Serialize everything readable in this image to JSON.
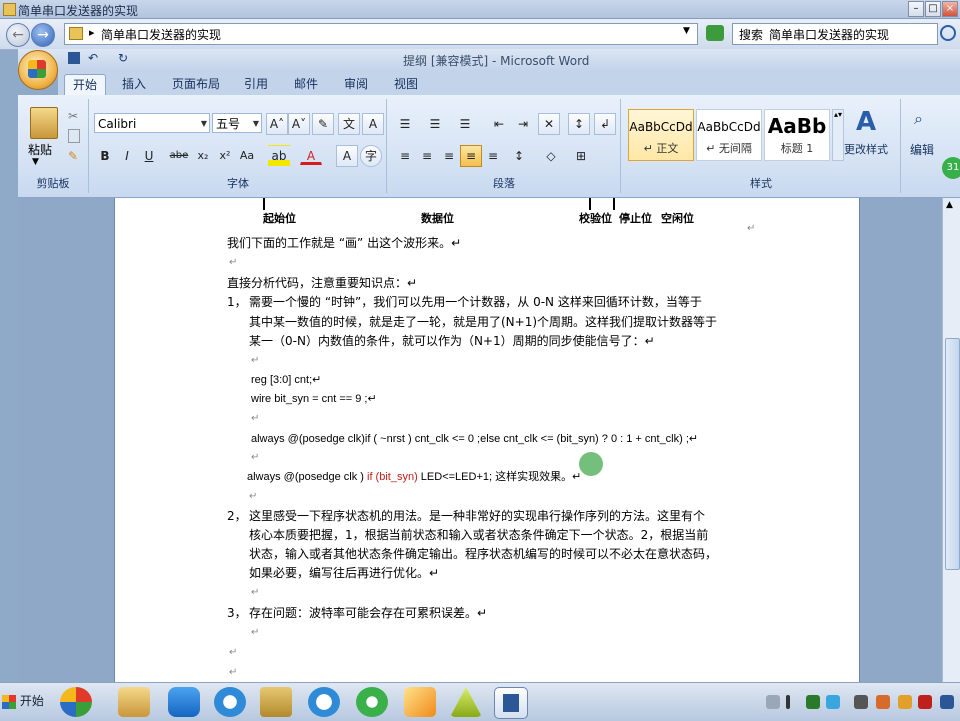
{
  "explorer": {
    "title": "简单串口发送器的实现",
    "address": "简单串口发送器的实现",
    "search_label": "搜索",
    "search_value": "简单串口发送器的实现"
  },
  "word": {
    "title": "提纲 [兼容模式] - Microsoft Word",
    "tabs": [
      "开始",
      "插入",
      "页面布局",
      "引用",
      "邮件",
      "审阅",
      "视图"
    ],
    "clipboard": {
      "paste_label": "粘贴",
      "group_label": "剪贴板"
    },
    "font": {
      "name": "Calibri",
      "size": "五号",
      "group_label": "字体",
      "buttons": [
        "B",
        "I",
        "U",
        "abe",
        "x₂",
        "x²",
        "Aa"
      ]
    },
    "paragraph": {
      "group_label": "段落"
    },
    "styles": {
      "group_label": "样式",
      "items": [
        {
          "preview": "AaBbCcDd",
          "name": "↵ 正文"
        },
        {
          "preview": "AaBbCcDd",
          "name": "↵ 无间隔"
        },
        {
          "preview": "AaBb",
          "name": "标题 1"
        }
      ],
      "change_label": "更改样式"
    },
    "editing": {
      "label": "编辑"
    },
    "badge": "31"
  },
  "document": {
    "diagram_labels": [
      "起始位",
      "数据位",
      "校验位",
      "停止位",
      "空闲位"
    ],
    "para1": "我们下面的工作就是 “画” 出这个波形来。↵",
    "para2": "直接分析代码，注意重要知识点：↵",
    "item1_num": "1，",
    "item1_line1": "需要一个慢的 “时钟”，我们可以先用一个计数器，从 0-N 这样来回循环计数，当等于",
    "item1_line2": "其中某一数值的时候，就是走了一轮，就是用了(N+1)个周期。这样我们提取计数器等于",
    "item1_line3": "某一（0-N）内数值的条件，就可以作为（N+1）周期的同步使能信号了：↵",
    "code1": "reg [3:0] cnt;↵",
    "code2": "wire bit_syn    = cnt == 9    ;↵",
    "code3": "always @(posedge clk)if ( ~nrst ) cnt_clk <= 0 ;else    cnt_clk <= (bit_syn) ? 0 : 1 + cnt_clk) ;↵",
    "code4_a": "always @(posedge clk ) ",
    "code4_b": "if (bit_syn)",
    "code4_c": " LED<=LED+1;  这样实现效果。↵",
    "item2_num": "2，",
    "item2_line1": "这里感受一下程序状态机的用法。是一种非常好的实现串行操作序列的方法。这里有个",
    "item2_line2": "核心本质要把握，1，根据当前状态和输入或者状态条件确定下一个状态。2，根据当前",
    "item2_line3": "状态，输入或者其他状态条件确定输出。程序状态机编写的时候可以不必太在意状态码，",
    "item2_line4": "如果必要，编写往后再进行优化。↵",
    "item3_num": "3，",
    "item3_line1": "存在问题：波特率可能会存在可累积误差。↵",
    "para_mark": "↵"
  },
  "taskbar": {
    "start_label": "开始"
  }
}
